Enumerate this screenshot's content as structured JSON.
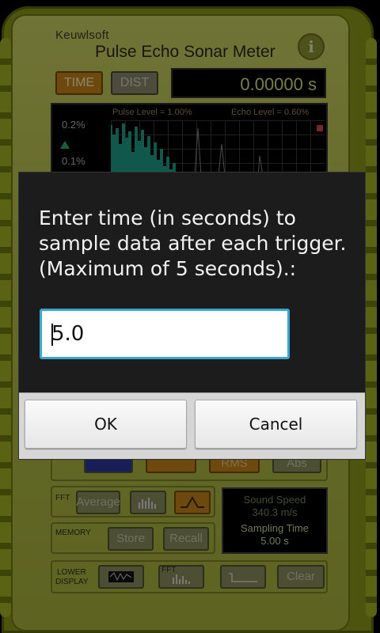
{
  "app": {
    "brand": "Keuwlsoft",
    "title": "Pulse Echo Sonar Meter",
    "info_label": "i"
  },
  "mode": {
    "time_label": "TIME",
    "dist_label": "DIST",
    "readout": "0.00000 s"
  },
  "scope": {
    "pulse_level": "Pulse Level = 1.00%",
    "echo_level": "Echo Level = 0.60%",
    "y_ticks": [
      "0.2%",
      "0.1%"
    ]
  },
  "partial_buttons": {
    "rms": "RMS",
    "abs": "Abs"
  },
  "fft": {
    "label": "FFT",
    "average": "Average"
  },
  "memory": {
    "label": "MEMORY",
    "store": "Store",
    "recall": "Recall"
  },
  "lower_display": {
    "label_line1": "LOWER",
    "label_line2": "DISPLAY",
    "fft_small": "FFT",
    "clear": "Clear"
  },
  "status_panel": {
    "sound_speed_label": "Sound Speed",
    "sound_speed_value": "340.3 m/s",
    "sampling_time_label": "Sampling Time",
    "sampling_time_value": "5.00 s"
  },
  "dialog": {
    "message": "Enter time (in seconds) to sample data after each trigger. (Maximum of 5 seconds).:",
    "input_value": "5.0",
    "ok_label": "OK",
    "cancel_label": "Cancel"
  }
}
